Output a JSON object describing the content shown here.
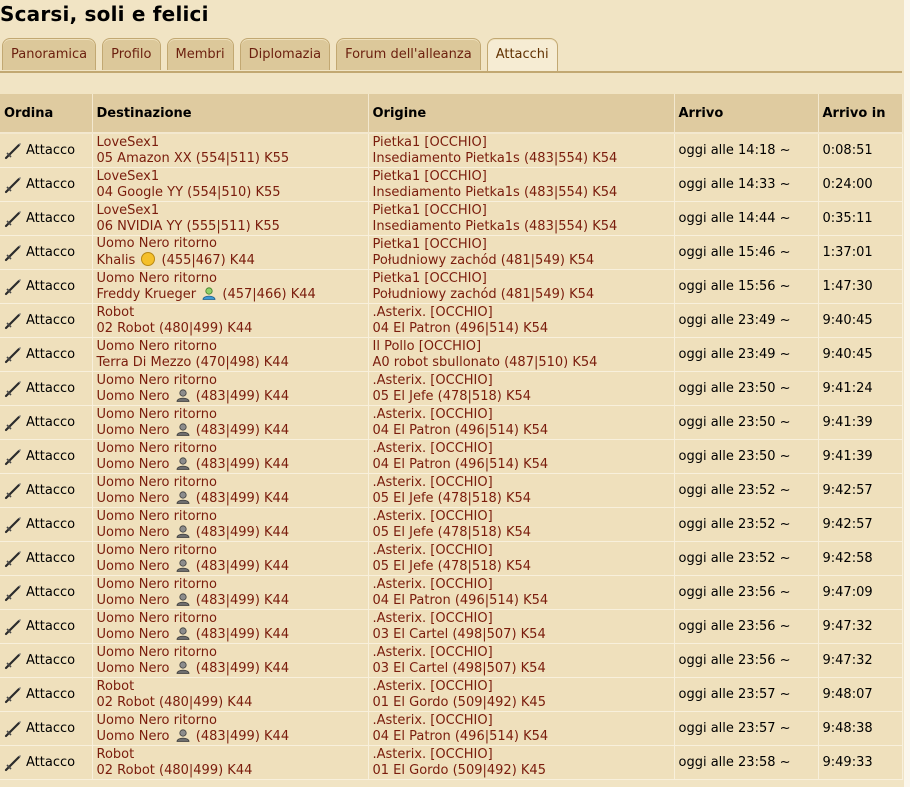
{
  "page_title": "Scarsi, soli e felici",
  "tabs": [
    {
      "label": "Panoramica",
      "active": false
    },
    {
      "label": "Profilo",
      "active": false
    },
    {
      "label": "Membri",
      "active": false
    },
    {
      "label": "Diplomazia",
      "active": false
    },
    {
      "label": "Forum dell'alleanza",
      "active": false
    },
    {
      "label": "Attacchi",
      "active": true
    }
  ],
  "table": {
    "headers": [
      "Ordina",
      "Destinazione",
      "Origine",
      "Arrivo",
      "Arrivo in"
    ],
    "rows": [
      {
        "command": "Attacco",
        "dest_player": "LoveSex1",
        "dest_village": "05 Amazon XX (554|511) K55",
        "dest_icon": "",
        "orig_player": "Pietka1 [OCCHIO]",
        "orig_village": "Insediamento Pietka1s (483|554) K54",
        "arrival": "oggi alle 14:18 ~",
        "arrival_in": "0:08:51"
      },
      {
        "command": "Attacco",
        "dest_player": "LoveSex1",
        "dest_village": "04 Google YY (554|510) K55",
        "dest_icon": "",
        "orig_player": "Pietka1 [OCCHIO]",
        "orig_village": "Insediamento Pietka1s (483|554) K54",
        "arrival": "oggi alle 14:33 ~",
        "arrival_in": "0:24:00"
      },
      {
        "command": "Attacco",
        "dest_player": "LoveSex1",
        "dest_village": "06 NVIDIA YY (555|511) K55",
        "dest_icon": "",
        "orig_player": "Pietka1 [OCCHIO]",
        "orig_village": "Insediamento Pietka1s (483|554) K54",
        "arrival": "oggi alle 14:44 ~",
        "arrival_in": "0:35:11"
      },
      {
        "command": "Attacco",
        "dest_player": "Uomo Nero ritorno",
        "dest_village": "Khalis",
        "dest_coords": "(455|467) K44",
        "dest_icon": "smiley-icon",
        "orig_player": "Pietka1 [OCCHIO]",
        "orig_village": "Południowy zachód (481|549) K54",
        "arrival": "oggi alle 15:46 ~",
        "arrival_in": "1:37:01"
      },
      {
        "command": "Attacco",
        "dest_player": "Uomo Nero ritorno",
        "dest_village": "Freddy Krueger",
        "dest_coords": "(457|466) K44",
        "dest_icon": "green-player-icon",
        "orig_player": "Pietka1 [OCCHIO]",
        "orig_village": "Południowy zachód (481|549) K54",
        "arrival": "oggi alle 15:56 ~",
        "arrival_in": "1:47:30"
      },
      {
        "command": "Attacco",
        "dest_player": "Robot",
        "dest_village": "02 Robot (480|499) K44",
        "dest_icon": "",
        "orig_player": ".Asterix. [OCCHIO]",
        "orig_village": "04 El Patron (496|514) K54",
        "arrival": "oggi alle 23:49 ~",
        "arrival_in": "9:40:45"
      },
      {
        "command": "Attacco",
        "dest_player": "Uomo Nero ritorno",
        "dest_village": "Terra Di Mezzo (470|498) K44",
        "dest_icon": "",
        "orig_player": "Il Pollo [OCCHIO]",
        "orig_village": "A0 robot sbullonato (487|510) K54",
        "arrival": "oggi alle 23:49 ~",
        "arrival_in": "9:40:45"
      },
      {
        "command": "Attacco",
        "dest_player": "Uomo Nero ritorno",
        "dest_village": "Uomo Nero",
        "dest_coords": "(483|499) K44",
        "dest_icon": "grey-player-icon",
        "orig_player": ".Asterix. [OCCHIO]",
        "orig_village": "05 El Jefe (478|518) K54",
        "arrival": "oggi alle 23:50 ~",
        "arrival_in": "9:41:24"
      },
      {
        "command": "Attacco",
        "dest_player": "Uomo Nero ritorno",
        "dest_village": "Uomo Nero",
        "dest_coords": "(483|499) K44",
        "dest_icon": "grey-player-icon",
        "orig_player": ".Asterix. [OCCHIO]",
        "orig_village": "04 El Patron (496|514) K54",
        "arrival": "oggi alle 23:50 ~",
        "arrival_in": "9:41:39"
      },
      {
        "command": "Attacco",
        "dest_player": "Uomo Nero ritorno",
        "dest_village": "Uomo Nero",
        "dest_coords": "(483|499) K44",
        "dest_icon": "grey-player-icon",
        "orig_player": ".Asterix. [OCCHIO]",
        "orig_village": "04 El Patron (496|514) K54",
        "arrival": "oggi alle 23:50 ~",
        "arrival_in": "9:41:39"
      },
      {
        "command": "Attacco",
        "dest_player": "Uomo Nero ritorno",
        "dest_village": "Uomo Nero",
        "dest_coords": "(483|499) K44",
        "dest_icon": "grey-player-icon",
        "orig_player": ".Asterix. [OCCHIO]",
        "orig_village": "05 El Jefe (478|518) K54",
        "arrival": "oggi alle 23:52 ~",
        "arrival_in": "9:42:57"
      },
      {
        "command": "Attacco",
        "dest_player": "Uomo Nero ritorno",
        "dest_village": "Uomo Nero",
        "dest_coords": "(483|499) K44",
        "dest_icon": "grey-player-icon",
        "orig_player": ".Asterix. [OCCHIO]",
        "orig_village": "05 El Jefe (478|518) K54",
        "arrival": "oggi alle 23:52 ~",
        "arrival_in": "9:42:57"
      },
      {
        "command": "Attacco",
        "dest_player": "Uomo Nero ritorno",
        "dest_village": "Uomo Nero",
        "dest_coords": "(483|499) K44",
        "dest_icon": "grey-player-icon",
        "orig_player": ".Asterix. [OCCHIO]",
        "orig_village": "05 El Jefe (478|518) K54",
        "arrival": "oggi alle 23:52 ~",
        "arrival_in": "9:42:58"
      },
      {
        "command": "Attacco",
        "dest_player": "Uomo Nero ritorno",
        "dest_village": "Uomo Nero",
        "dest_coords": "(483|499) K44",
        "dest_icon": "grey-player-icon",
        "orig_player": ".Asterix. [OCCHIO]",
        "orig_village": "04 El Patron (496|514) K54",
        "arrival": "oggi alle 23:56 ~",
        "arrival_in": "9:47:09"
      },
      {
        "command": "Attacco",
        "dest_player": "Uomo Nero ritorno",
        "dest_village": "Uomo Nero",
        "dest_coords": "(483|499) K44",
        "dest_icon": "grey-player-icon",
        "orig_player": ".Asterix. [OCCHIO]",
        "orig_village": "03 El Cartel (498|507) K54",
        "arrival": "oggi alle 23:56 ~",
        "arrival_in": "9:47:32"
      },
      {
        "command": "Attacco",
        "dest_player": "Uomo Nero ritorno",
        "dest_village": "Uomo Nero",
        "dest_coords": "(483|499) K44",
        "dest_icon": "grey-player-icon",
        "orig_player": ".Asterix. [OCCHIO]",
        "orig_village": "03 El Cartel (498|507) K54",
        "arrival": "oggi alle 23:56 ~",
        "arrival_in": "9:47:32"
      },
      {
        "command": "Attacco",
        "dest_player": "Robot",
        "dest_village": "02 Robot (480|499) K44",
        "dest_icon": "",
        "orig_player": ".Asterix. [OCCHIO]",
        "orig_village": "01 El Gordo (509|492) K45",
        "arrival": "oggi alle 23:57 ~",
        "arrival_in": "9:48:07"
      },
      {
        "command": "Attacco",
        "dest_player": "Uomo Nero ritorno",
        "dest_village": "Uomo Nero",
        "dest_coords": "(483|499) K44",
        "dest_icon": "grey-player-icon",
        "orig_player": ".Asterix. [OCCHIO]",
        "orig_village": "04 El Patron (496|514) K54",
        "arrival": "oggi alle 23:57 ~",
        "arrival_in": "9:48:38"
      },
      {
        "command": "Attacco",
        "dest_player": "Robot",
        "dest_village": "02 Robot (480|499) K44",
        "dest_icon": "",
        "orig_player": ".Asterix. [OCCHIO]",
        "orig_village": "01 El Gordo (509|492) K45",
        "arrival": "oggi alle 23:58 ~",
        "arrival_in": "9:49:33"
      }
    ]
  },
  "colors": {
    "link": "#7a1c0c",
    "header_bg": "#dfcba0",
    "row_bg": "#efe0bc",
    "page_bg": "#f1e4c4"
  }
}
